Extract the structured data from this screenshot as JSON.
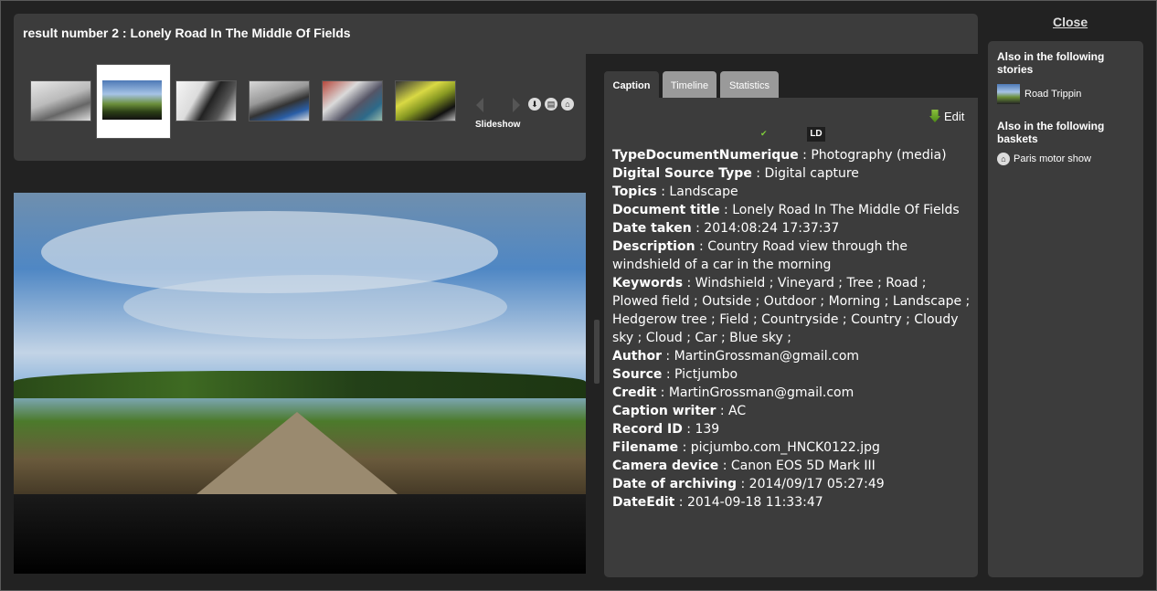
{
  "header": {
    "title": "result number 2 : Lonely Road In The Middle Of Fields"
  },
  "close_label": "Close",
  "thumbnails": {
    "slideshow_label": "Slideshow",
    "icons": [
      "download-icon",
      "print-icon",
      "basket-icon"
    ]
  },
  "tabs": [
    {
      "label": "Caption",
      "active": true
    },
    {
      "label": "Timeline",
      "active": false
    },
    {
      "label": "Statistics",
      "active": false
    }
  ],
  "caption": {
    "edit_label": "Edit",
    "check": "✔",
    "ld_label": "LD",
    "fields": [
      {
        "key": "TypeDocumentNumerique",
        "value": "Photography (media)"
      },
      {
        "key": "Digital Source Type",
        "value": "Digital capture"
      },
      {
        "key": "Topics",
        "value": "Landscape"
      },
      {
        "key": "Document title",
        "value": "Lonely Road In The Middle Of Fields"
      },
      {
        "key": "Date taken",
        "value": "2014:08:24 17:37:37"
      },
      {
        "key": "Description",
        "value": "Country Road view through the windshield of a car in the morning"
      },
      {
        "key": "Keywords",
        "value": "Windshield ; Vineyard ; Tree ; Road ; Plowed field ; Outside ; Outdoor ; Morning ; Landscape ; Hedgerow tree ; Field ; Countryside ; Country ; Cloudy sky ; Cloud ; Car ; Blue sky ;"
      },
      {
        "key": "Author",
        "value": "MartinGrossman@gmail.com"
      },
      {
        "key": "Source",
        "value": "Pictjumbo"
      },
      {
        "key": "Credit",
        "value": "MartinGrossman@gmail.com"
      },
      {
        "key": "Caption writer",
        "value": "AC"
      },
      {
        "key": "Record ID",
        "value": "139"
      },
      {
        "key": "Filename",
        "value": "picjumbo.com_HNCK0122.jpg"
      },
      {
        "key": "Camera device",
        "value": "Canon EOS 5D Mark III"
      },
      {
        "key": "Date of archiving",
        "value": "2014/09/17 05:27:49"
      },
      {
        "key": "DateEdit",
        "value": "2014-09-18 11:33:47"
      }
    ]
  },
  "side": {
    "stories_heading": "Also in the following stories",
    "story_item": "Road Trippin",
    "baskets_heading": "Also in the following baskets",
    "basket_item": "Paris motor show"
  },
  "colors": {
    "panel": "#3c3c3c",
    "background": "#222222",
    "inactive_tab": "#9a9a9a",
    "accent_green": "#7fcf3a"
  }
}
